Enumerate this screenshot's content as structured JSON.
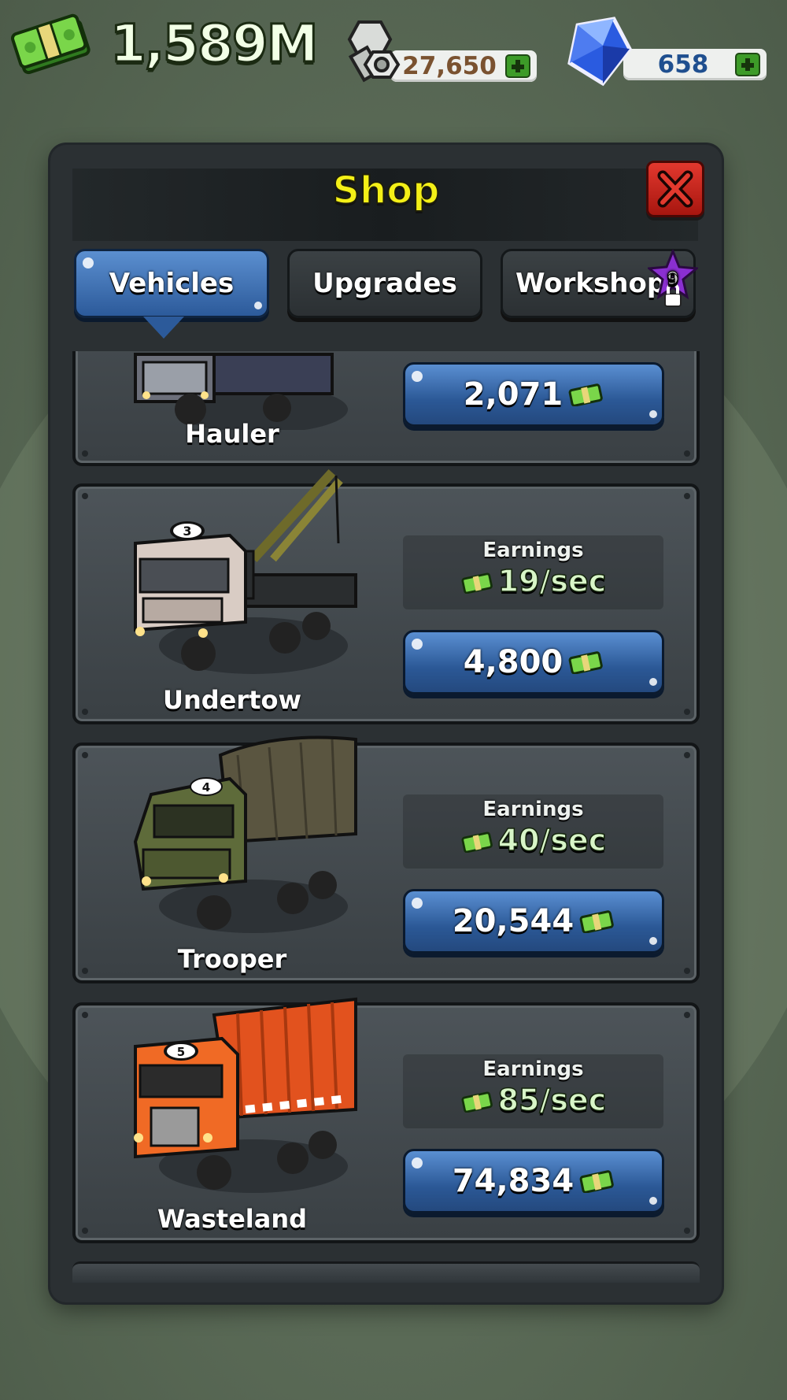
{
  "hud": {
    "cash": "1,589M",
    "cash_icon": "cash-stack-icon",
    "bolts": "27,650",
    "bolts_icon": "nut-bolt-icon",
    "gems": "658",
    "gems_icon": "blue-gem-icon",
    "bolts_color": "#7a5230",
    "gems_color": "#1f4f8f"
  },
  "shop": {
    "title": "Shop",
    "tabs": [
      {
        "label": "Vehicles",
        "active": true
      },
      {
        "label": "Upgrades",
        "active": false
      },
      {
        "label": "Workshop",
        "active": false,
        "badge": "9",
        "badge_icon": "purple-star-lock-icon"
      }
    ]
  },
  "vehicles": [
    {
      "name": "Hauler",
      "price": "2,071",
      "earnings_label": "",
      "earnings": ""
    },
    {
      "name": "Undertow",
      "number": "3",
      "earnings_label": "Earnings",
      "earnings": "19/sec",
      "price": "4,800"
    },
    {
      "name": "Trooper",
      "number": "4",
      "earnings_label": "Earnings",
      "earnings": "40/sec",
      "price": "20,544"
    },
    {
      "name": "Wasteland",
      "number": "5",
      "earnings_label": "Earnings",
      "earnings": "85/sec",
      "price": "74,834"
    }
  ],
  "colors": {
    "title_yellow": "#f4f017",
    "button_blue": "#2c5a9a",
    "close_red": "#c8241b"
  }
}
